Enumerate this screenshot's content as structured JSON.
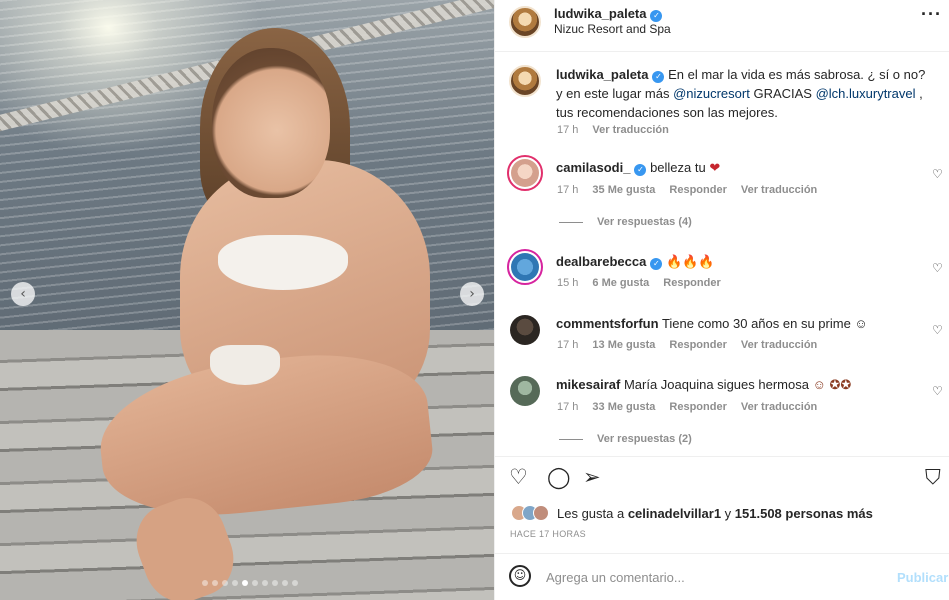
{
  "post": {
    "username": "ludwika_paleta",
    "location": "Nizuc Resort and Spa",
    "more_icon": "more-horizontal-icon",
    "caption_text_1": "En el mar la vida es más sabrosa. ¿ sí o no? y en este lugar más ",
    "caption_mention_1": "@nizucresort",
    "caption_text_2": " GRACIAS ",
    "caption_mention_2": "@lch.luxurytravel",
    "caption_text_3": " , tus recomendaciones son las mejores.",
    "caption_time": "17 h",
    "caption_translate": "Ver traducción"
  },
  "photo": {
    "slides_count": 10,
    "active_slide": 4
  },
  "comments": [
    {
      "username": "camilasodi_",
      "verified": true,
      "text": "belleza tu",
      "emoji": "❤",
      "time": "17 h",
      "likes": "35 Me gusta",
      "reply": "Responder",
      "translate": "Ver traducción",
      "replies": "Ver respuestas (4)"
    },
    {
      "username": "dealbarebecca",
      "verified": true,
      "text": "",
      "emoji": "🔥🔥🔥",
      "time": "15 h",
      "likes": "6 Me gusta",
      "reply": "Responder"
    },
    {
      "username": "commentsforfun",
      "verified": false,
      "text": "Tiene como 30 años en su prime",
      "emoji": "☺",
      "time": "17 h",
      "likes": "13 Me gusta",
      "reply": "Responder",
      "translate": "Ver traducción"
    },
    {
      "username": "mikesairaf",
      "verified": false,
      "text": "María Joaquina sigues hermosa",
      "emoji": "☺ ✪✪",
      "time": "17 h",
      "likes": "33 Me gusta",
      "reply": "Responder",
      "translate": "Ver traducción",
      "replies": "Ver respuestas (2)"
    }
  ],
  "likes": {
    "prefix": "Les gusta a ",
    "user": "celinadelvillar1",
    "middle": " y ",
    "count": "151.508 personas más"
  },
  "timestamp": "HACE 17 HORAS",
  "add_comment": {
    "placeholder": "Agrega un comentario...",
    "publish": "Publicar"
  }
}
